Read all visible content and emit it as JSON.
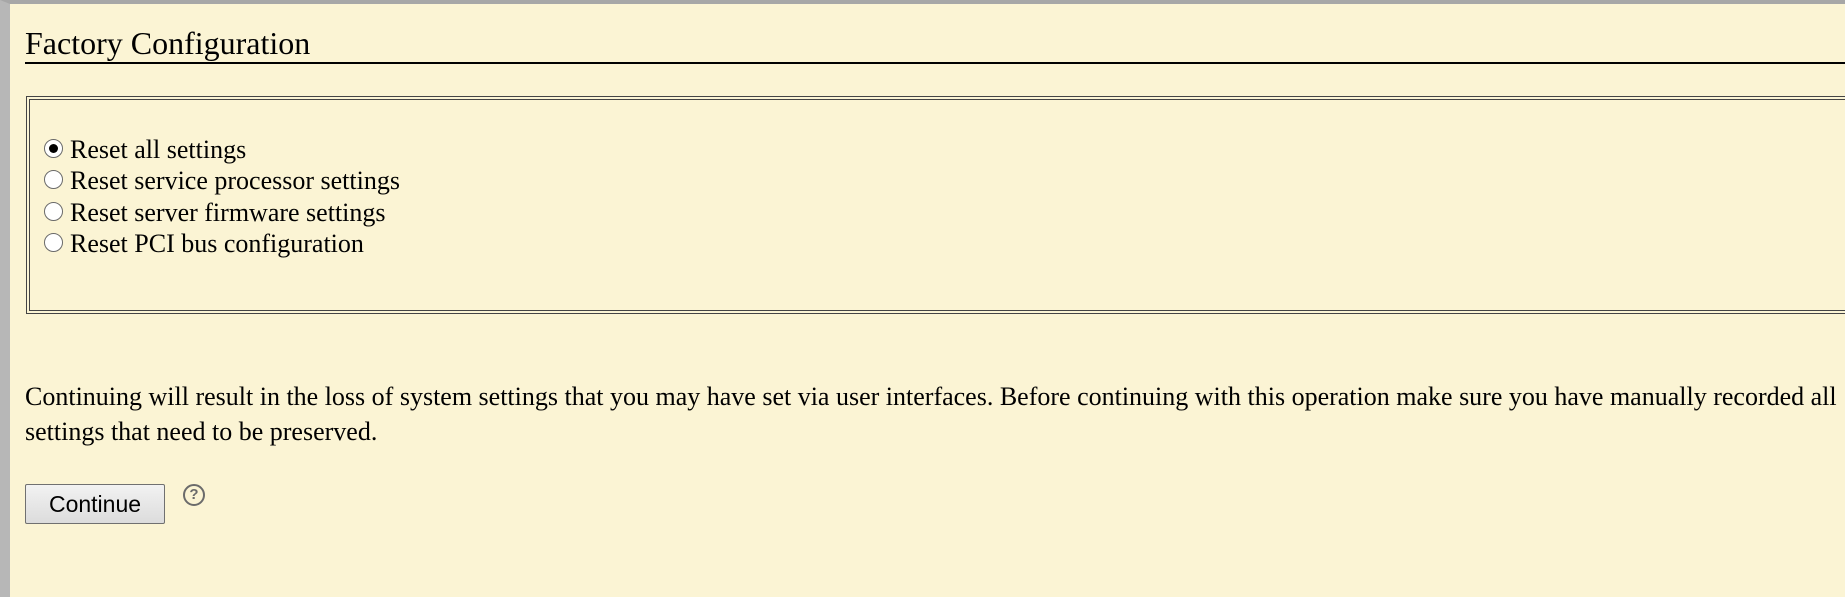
{
  "page": {
    "title": "Factory Configuration"
  },
  "options": [
    {
      "label": "Reset all settings",
      "selected": true
    },
    {
      "label": "Reset service processor settings",
      "selected": false
    },
    {
      "label": "Reset server firmware settings",
      "selected": false
    },
    {
      "label": "Reset PCI bus configuration",
      "selected": false
    }
  ],
  "warning": {
    "text": "Continuing will result in the loss of system settings that you may have set via user interfaces. Before continuing with this operation make sure you have manually recorded all settings that need to be preserved."
  },
  "actions": {
    "continue_label": "Continue",
    "help_symbol": "?",
    "help_icon": "help-circle-icon"
  },
  "colors": {
    "background": "#fbf4d4",
    "frame_border": "#b7b7b7",
    "text": "#000000"
  }
}
